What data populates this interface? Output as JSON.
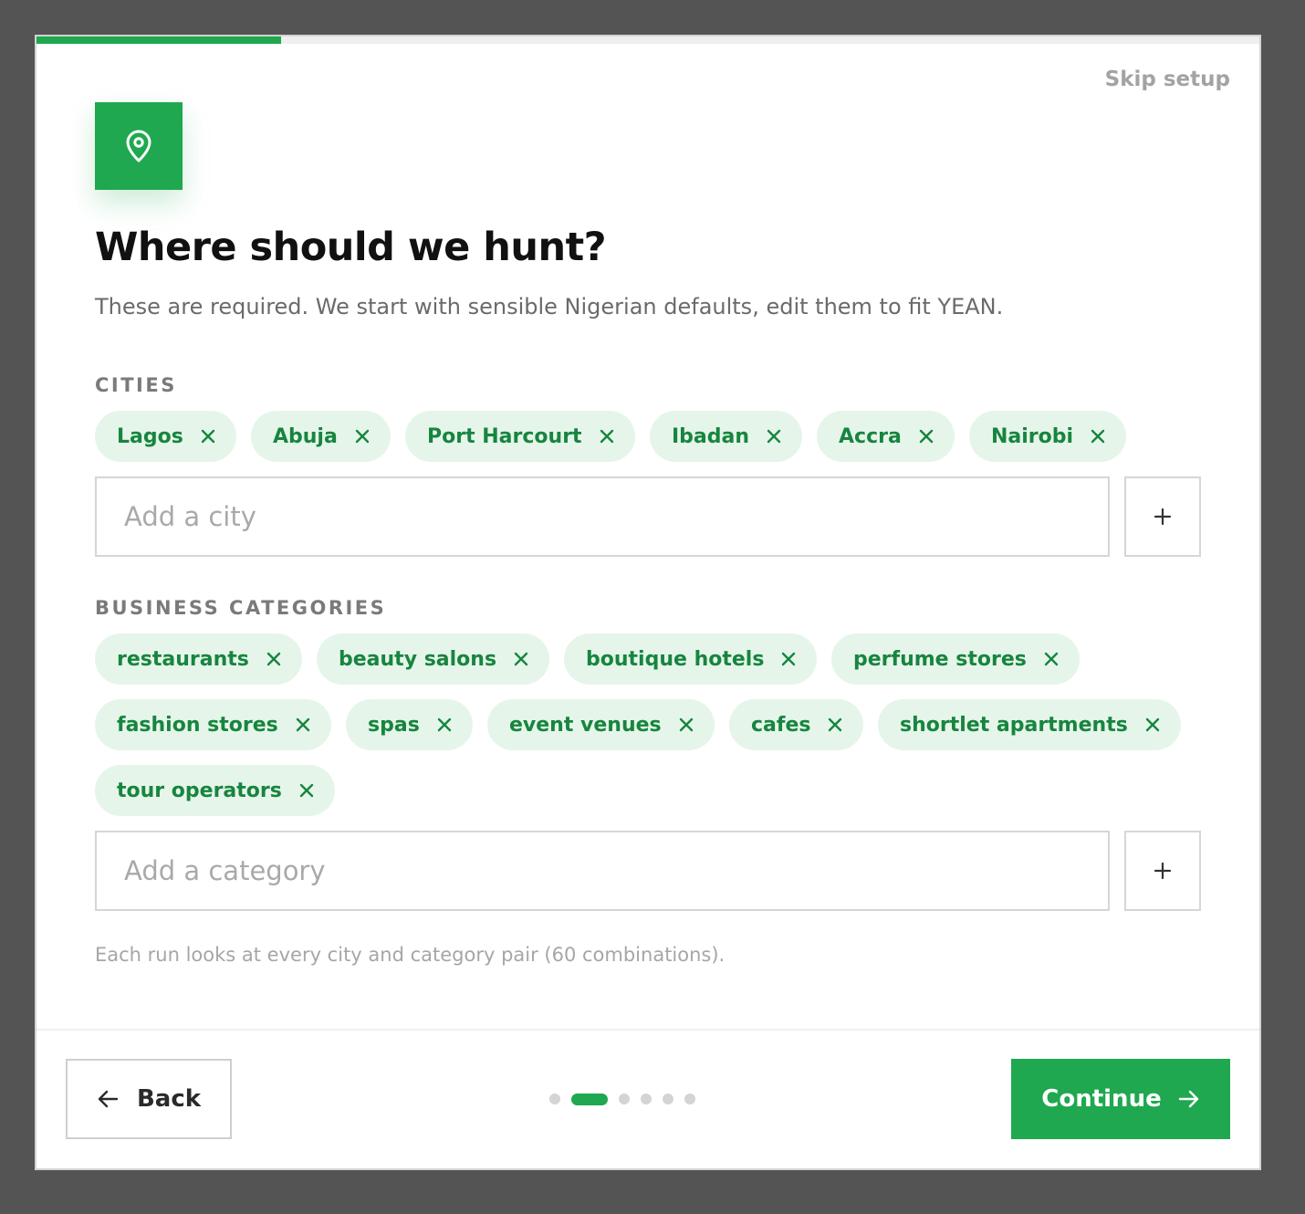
{
  "progress": {
    "fraction": 0.2
  },
  "header": {
    "skip_label": "Skip setup"
  },
  "hero": {
    "icon": "map-pin-icon",
    "accent": "#1fa84f"
  },
  "title": "Where should we hunt?",
  "subtitle": "These are required. We start with sensible Nigerian defaults, edit them to fit YEAN.",
  "cities": {
    "label": "CITIES",
    "items": [
      "Lagos",
      "Abuja",
      "Port Harcourt",
      "Ibadan",
      "Accra",
      "Nairobi"
    ],
    "input_placeholder": "Add a city",
    "add_icon": "plus-icon"
  },
  "categories": {
    "label": "BUSINESS CATEGORIES",
    "items": [
      "restaurants",
      "beauty salons",
      "boutique hotels",
      "perfume stores",
      "fashion stores",
      "spas",
      "event venues",
      "cafes",
      "shortlet apartments",
      "tour operators"
    ],
    "input_placeholder": "Add a category",
    "add_icon": "plus-icon"
  },
  "hint": "Each run looks at every city and category pair (60 combinations).",
  "footer": {
    "back_label": "Back",
    "continue_label": "Continue",
    "step_count": 6,
    "current_step": 2
  },
  "colors": {
    "accent": "#1fa84f",
    "chip_bg": "#e6f5ea",
    "chip_text": "#17853f"
  }
}
